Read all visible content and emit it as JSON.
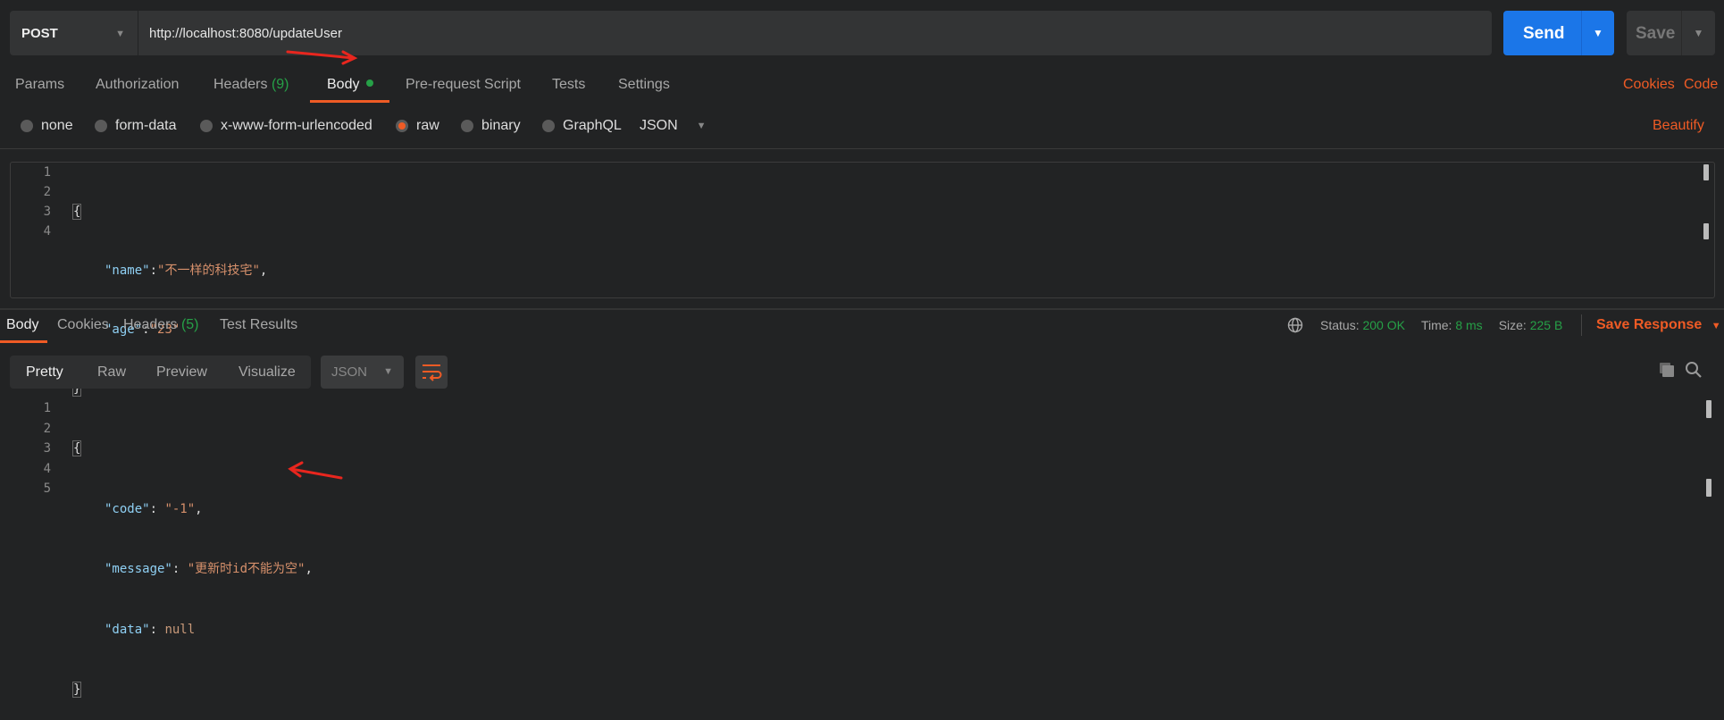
{
  "request": {
    "method": "POST",
    "url": "http://localhost:8080/updateUser",
    "send_label": "Send",
    "save_label": "Save"
  },
  "req_tabs": [
    {
      "label": "Params"
    },
    {
      "label": "Authorization"
    },
    {
      "label": "Headers",
      "count": "(9)"
    },
    {
      "label": "Body",
      "active": true
    },
    {
      "label": "Pre-request Script"
    },
    {
      "label": "Tests"
    },
    {
      "label": "Settings"
    }
  ],
  "req_links": {
    "cookies": "Cookies",
    "code": "Code",
    "beautify": "Beautify"
  },
  "body_types": [
    "none",
    "form-data",
    "x-www-form-urlencoded",
    "raw",
    "binary",
    "GraphQL"
  ],
  "body_type_selected": "raw",
  "body_format": "JSON",
  "request_body": {
    "line_numbers": [
      "1",
      "2",
      "3",
      "4"
    ],
    "open": "{",
    "close": "}",
    "name_key": "\"name\"",
    "name_value": "\"不一样的科技宅\"",
    "age_key": "\"age\"",
    "age_value": "\"23\""
  },
  "resp_tabs": [
    {
      "label": "Body",
      "active": true
    },
    {
      "label": "Cookies"
    },
    {
      "label": "Headers",
      "count": "(5)"
    },
    {
      "label": "Test Results"
    }
  ],
  "status": {
    "status_label": "Status:",
    "status_value": "200 OK",
    "time_label": "Time:",
    "time_value": "8 ms",
    "size_label": "Size:",
    "size_value": "225 B",
    "save_response": "Save Response"
  },
  "view_modes": [
    "Pretty",
    "Raw",
    "Preview",
    "Visualize"
  ],
  "response_format": "JSON",
  "response_body": {
    "line_numbers": [
      "1",
      "2",
      "3",
      "4",
      "5"
    ],
    "open": "{",
    "close": "}",
    "code_key": "\"code\"",
    "code_value": "\"-1\"",
    "message_key": "\"message\"",
    "message_value": "\"更新时id不能为空\"",
    "data_key": "\"data\"",
    "data_value": "null"
  },
  "colors": {
    "accent": "#ef5b25",
    "send": "#1b76e8",
    "success": "#26a047",
    "annotation_arrow": "#e8261e"
  }
}
